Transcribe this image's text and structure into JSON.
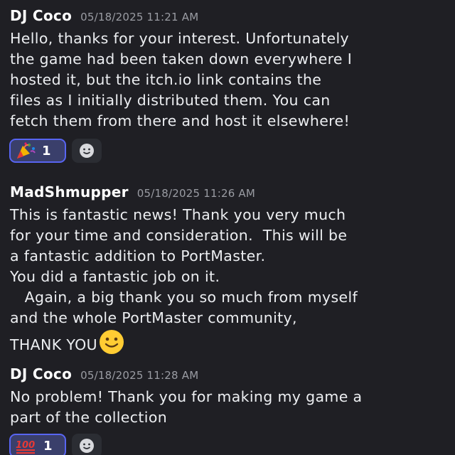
{
  "messages": [
    {
      "author": "DJ Coco",
      "timestamp": "05/18/2025 11:21 AM",
      "lines": [
        "Hello, thanks for your interest. Unfortunately",
        "the game had been taken down everywhere I",
        "hosted it, but the itch.io link contains the",
        "files as I initially distributed them. You can",
        "fetch them from there and host it elsewhere!"
      ],
      "reaction": {
        "emoji": "party-popper-icon",
        "count": "1"
      }
    },
    {
      "author": "MadShmupper",
      "timestamp": "05/18/2025 11:26 AM",
      "lines": [
        "This is fantastic news! Thank you very much",
        "for your time and consideration.  This will be",
        "a fantastic addition to PortMaster.",
        "You did a fantastic job on it.",
        "   Again, a big thank you so much from myself",
        "and the whole PortMaster community,",
        "THANK YOU"
      ],
      "inline_emoji": "slightly-smiling-face-icon"
    },
    {
      "author": "DJ Coco",
      "timestamp": "05/18/2025 11:28 AM",
      "lines": [
        "No problem! Thank you for making my game a",
        "part of the collection"
      ],
      "reaction": {
        "emoji": "hundred-points-icon",
        "count": "1"
      }
    }
  ],
  "colors": {
    "background": "#1f1f24",
    "reaction_active_bg": "#3a3f6b",
    "reaction_active_border": "#5865f2",
    "timestamp": "#9a9ca3"
  }
}
